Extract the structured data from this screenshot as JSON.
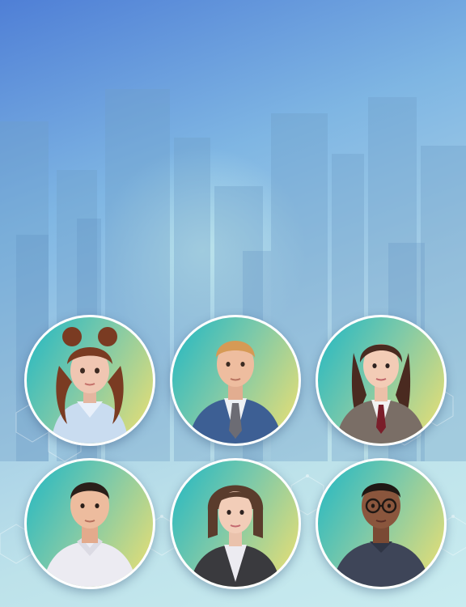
{
  "colors": {
    "ring": "#ffffff",
    "avatar_gradient_start": "#1fb7c4",
    "avatar_gradient_end": "#f0e070",
    "background_top": "#4f7fd6",
    "background_bottom": "#c9ecf0"
  },
  "avatars": [
    {
      "id": "a1",
      "description_icon": "avatar-woman-curly-hair"
    },
    {
      "id": "a2",
      "description_icon": "avatar-man-suit-tie"
    },
    {
      "id": "a3",
      "description_icon": "avatar-woman-blazer-tie"
    },
    {
      "id": "a4",
      "description_icon": "avatar-man-white-shirt"
    },
    {
      "id": "a5",
      "description_icon": "avatar-woman-bob-blazer"
    },
    {
      "id": "a6",
      "description_icon": "avatar-man-glasses"
    }
  ]
}
